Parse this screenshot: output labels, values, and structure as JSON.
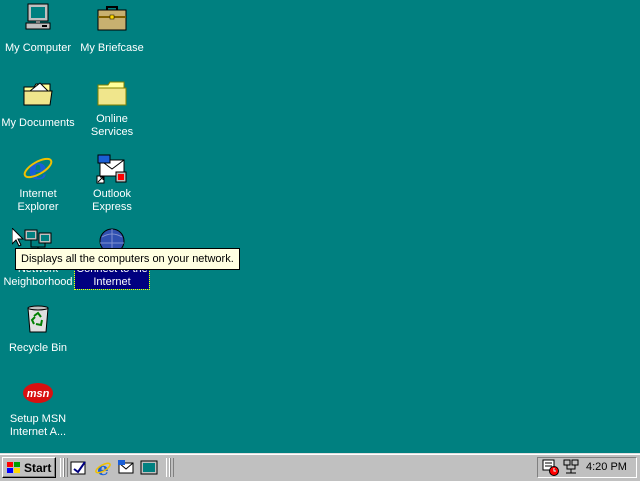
{
  "desktop": {
    "background": "#008080",
    "icons": [
      {
        "label": "My Computer",
        "icon": "my-computer-icon"
      },
      {
        "label": "My Briefcase",
        "icon": "briefcase-icon"
      },
      {
        "label": "My Documents",
        "icon": "my-documents-icon"
      },
      {
        "label": "Online\nServices",
        "icon": "folder-icon"
      },
      {
        "label": "Internet\nExplorer",
        "icon": "internet-explorer-icon"
      },
      {
        "label": "Outlook\nExpress",
        "icon": "outlook-express-icon"
      },
      {
        "label": "Network\nNeighborhood",
        "icon": "network-neighborhood-icon"
      },
      {
        "label": "Connect to the\nInternet",
        "icon": "connect-internet-icon"
      },
      {
        "label": "Recycle Bin",
        "icon": "recycle-bin-icon"
      },
      {
        "label": "Setup MSN\nInternet A...",
        "icon": "msn-icon"
      }
    ],
    "tooltip": "Displays all the computers on your network."
  },
  "taskbar": {
    "start_label": "Start",
    "quick_launch": [
      "show-desktop-icon",
      "internet-explorer-icon",
      "outlook-express-icon",
      "channels-icon"
    ],
    "tray": {
      "icons": [
        "scheduler-icon",
        "network-tray-icon"
      ],
      "clock": "4:20 PM"
    }
  }
}
